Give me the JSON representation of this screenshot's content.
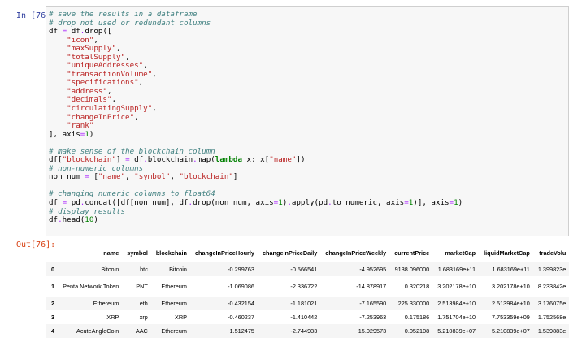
{
  "in_prompt": "In [76]:",
  "out_prompt": "Out[76]:",
  "code": {
    "c1": "# save the results in a dataframe",
    "c2": "# drop not used or redundant columns",
    "drop_columns": [
      "\"icon\"",
      "\"maxSupply\"",
      "\"totalSupply\"",
      "\"uniqueAddresses\"",
      "\"transactionVolume\"",
      "\"specifications\"",
      "\"address\"",
      "\"decimals\"",
      "\"circulatingSupply\"",
      "\"changeInPrice\"",
      "\"rank\""
    ],
    "c3": "# make sense of the blockchain column",
    "s_blockchain": "\"blockchain\"",
    "s_name": "\"name\"",
    "s_symbol": "\"symbol\"",
    "c4": "# non-numeric columns",
    "c5": "# changing numeric columns to float64",
    "c6": "# display results"
  },
  "table": {
    "columns": [
      "",
      "name",
      "symbol",
      "blockchain",
      "changeInPriceHourly",
      "changeInPriceDaily",
      "changeInPriceWeekly",
      "currentPrice",
      "marketCap",
      "liquidMarketCap",
      "tradeVolu"
    ],
    "rows": [
      [
        "0",
        "Bitcoin",
        "btc",
        "Bitcoin",
        "-0.299763",
        "-0.566541",
        "-4.952695",
        "9138.096000",
        "1.683169e+11",
        "1.683169e+11",
        "1.399823e"
      ],
      [
        "1",
        "Penta Network Token",
        "PNT",
        "Ethereum",
        "-1.069086",
        "-2.336722",
        "-14.878917",
        "0.320218",
        "3.202178e+10",
        "3.202178e+10",
        "8.233842e"
      ],
      [
        "2",
        "Ethereum",
        "eth",
        "Ethereum",
        "-0.432154",
        "-1.181021",
        "-7.165590",
        "225.330000",
        "2.513984e+10",
        "2.513984e+10",
        "3.176075e"
      ],
      [
        "3",
        "XRP",
        "xrp",
        "XRP",
        "-0.460237",
        "-1.410442",
        "-7.253963",
        "0.175186",
        "1.751704e+10",
        "7.753359e+09",
        "1.752568e"
      ],
      [
        "4",
        "AcuteAngleCoin",
        "AAC",
        "Ethereum",
        "1.512475",
        "-2.744933",
        "15.029573",
        "0.052108",
        "5.210839e+07",
        "5.210839e+07",
        "1.539883e"
      ]
    ]
  }
}
